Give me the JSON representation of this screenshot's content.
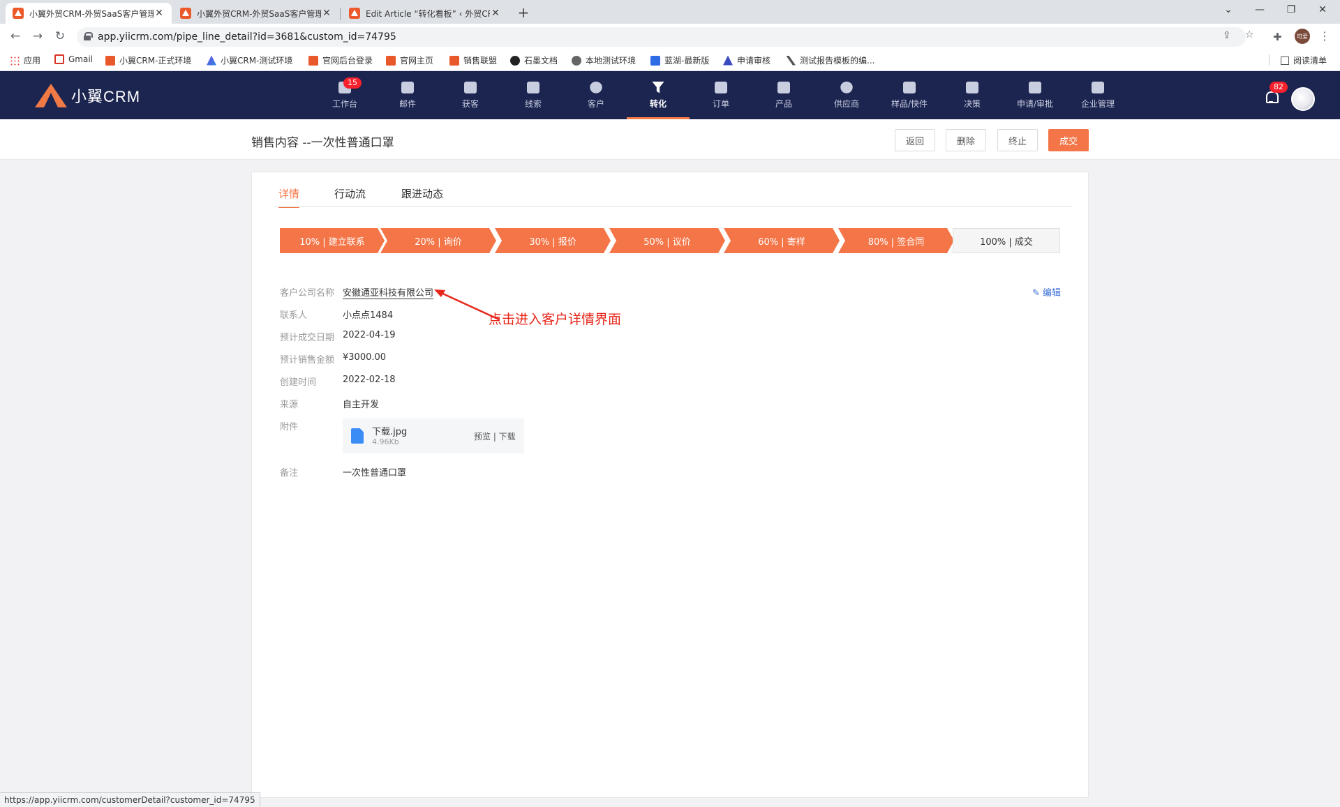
{
  "browser": {
    "tabs": [
      {
        "title": "小翼外贸CRM-外贸SaaS客户管理",
        "active": true
      },
      {
        "title": "小翼外贸CRM-外贸SaaS客户管理",
        "active": false
      },
      {
        "title": "Edit Article “转化看板” ‹ 外贸CR",
        "active": false
      }
    ],
    "url": "app.yiicrm.com/pipe_line_detail?id=3681&custom_id=74795",
    "avatar_text": "可爱",
    "bookmarks": [
      "应用",
      "Gmail",
      "小翼CRM-正式环境",
      "小翼CRM-测试环境",
      "官网后台登录",
      "官网主页",
      "销售联盟",
      "石墨文档",
      "本地测试环境",
      "蓝湖-最新版",
      "申请审核",
      "测试报告模板的编..."
    ],
    "reading_list": "阅读清单",
    "status_url": "https://app.yiicrm.com/customerDetail?customer_id=74795"
  },
  "app": {
    "logo_text": "小翼CRM",
    "nav": [
      {
        "label": "工作台",
        "badge": "15"
      },
      {
        "label": "邮件"
      },
      {
        "label": "获客"
      },
      {
        "label": "线索"
      },
      {
        "label": "客户"
      },
      {
        "label": "转化",
        "active": true
      },
      {
        "label": "订单"
      },
      {
        "label": "产品"
      },
      {
        "label": "供应商"
      },
      {
        "label": "样品/快件"
      },
      {
        "label": "决策"
      },
      {
        "label": "申请/审批"
      },
      {
        "label": "企业管理"
      }
    ],
    "notification_count": "82"
  },
  "page": {
    "title": "销售内容 --一次性普通口罩",
    "buttons": {
      "back": "返回",
      "delete": "删除",
      "terminate": "终止",
      "deal": "成交"
    },
    "tabs": [
      "详情",
      "行动流",
      "跟进动态"
    ],
    "stages": [
      {
        "label": "10% | 建立联系",
        "done": true
      },
      {
        "label": "20% | 询价",
        "done": true
      },
      {
        "label": "30% | 报价",
        "done": true
      },
      {
        "label": "50% | 议价",
        "done": true
      },
      {
        "label": "60% | 寄样",
        "done": true
      },
      {
        "label": "80% | 签合同",
        "done": true
      },
      {
        "label": "100% | 成交",
        "done": false
      }
    ],
    "edit_label": "编辑",
    "fields": {
      "company_label": "客户公司名称",
      "company": "安徽通亚科技有限公司",
      "contact_label": "联系人",
      "contact": "小点点1484",
      "expected_date_label": "预计成交日期",
      "expected_date": "2022-04-19",
      "expected_amount_label": "预计销售金额",
      "expected_amount": "¥3000.00",
      "created_label": "创建时间",
      "created": "2022-02-18",
      "source_label": "来源",
      "source": "自主开发",
      "attachment_label": "附件",
      "remark_label": "备注",
      "remark": "一次性普通口罩"
    },
    "attachment": {
      "name": "下载.jpg",
      "size": "4.96Kb",
      "actions": "预览 | 下载"
    },
    "annotation": "点击进入客户详情界面"
  },
  "colors": {
    "accent": "#f47648",
    "header_bg": "#1c2550",
    "annotation": "#e8271b"
  }
}
